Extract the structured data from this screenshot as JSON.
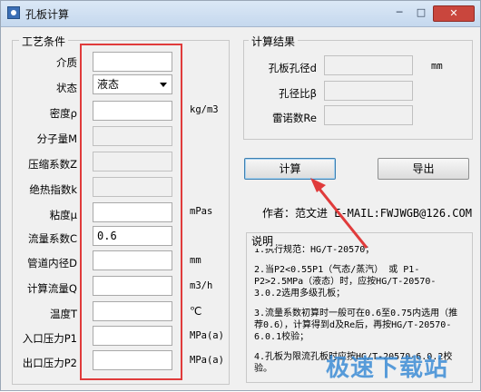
{
  "window": {
    "title": "孔板计算",
    "minimize": "─",
    "maximize": "□",
    "close": "✕"
  },
  "process": {
    "title": "工艺条件",
    "rows": [
      {
        "label": "介质",
        "value": "",
        "unit": "",
        "disabled": false
      },
      {
        "label": "状态",
        "value": "液态",
        "unit": "",
        "select": true
      },
      {
        "label": "密度ρ",
        "value": "",
        "unit": "kg/m3",
        "disabled": false
      },
      {
        "label": "分子量M",
        "value": "",
        "unit": "",
        "disabled": true
      },
      {
        "label": "压缩系数Z",
        "value": "",
        "unit": "",
        "disabled": true
      },
      {
        "label": "绝热指数k",
        "value": "",
        "unit": "",
        "disabled": true
      },
      {
        "label": "粘度μ",
        "value": "",
        "unit": "mPas",
        "disabled": false
      },
      {
        "label": "流量系数C",
        "value": "0.6",
        "unit": "",
        "disabled": false
      },
      {
        "label": "管道内径D",
        "value": "",
        "unit": "mm",
        "disabled": false
      },
      {
        "label": "计算流量Q",
        "value": "",
        "unit": "m3/h",
        "disabled": false
      },
      {
        "label": "温度T",
        "value": "",
        "unit": "℃",
        "disabled": false
      },
      {
        "label": "入口压力P1",
        "value": "",
        "unit": "MPa(a)",
        "disabled": false
      },
      {
        "label": "出口压力P2",
        "value": "",
        "unit": "MPa(a)",
        "disabled": false
      }
    ]
  },
  "results": {
    "title": "计算结果",
    "rows": [
      {
        "label": "孔板孔径d",
        "value": "",
        "unit": "mm"
      },
      {
        "label": "孔径比β",
        "value": "",
        "unit": ""
      },
      {
        "label": "雷诺数Re",
        "value": "",
        "unit": ""
      }
    ]
  },
  "buttons": {
    "calculate": "计算",
    "export": "导出"
  },
  "author": "作者：范文进  E-MAIL:FWJWGB@126.COM",
  "notes": {
    "title": "说明",
    "items": [
      "1.执行规范：HG/T-20570；",
      "2.当P2<0.55P1（气态/蒸汽） 或 P1-P2>2.5MPa（液态）时，应按HG/T-20570-3.0.2选用多级孔板；",
      "3.流量系数初算时一般可在0.6至0.75内选用（推荐0.6），计算得到d及Re后，再按HG/T-20570-6.0.1校验；",
      "4.孔板为限流孔板时应按HG/T-20570-6.0.2校验。"
    ]
  },
  "watermark": "极速下载站",
  "colors": {
    "highlight": "#e03b3b",
    "watermark": "#3d8dd6"
  }
}
